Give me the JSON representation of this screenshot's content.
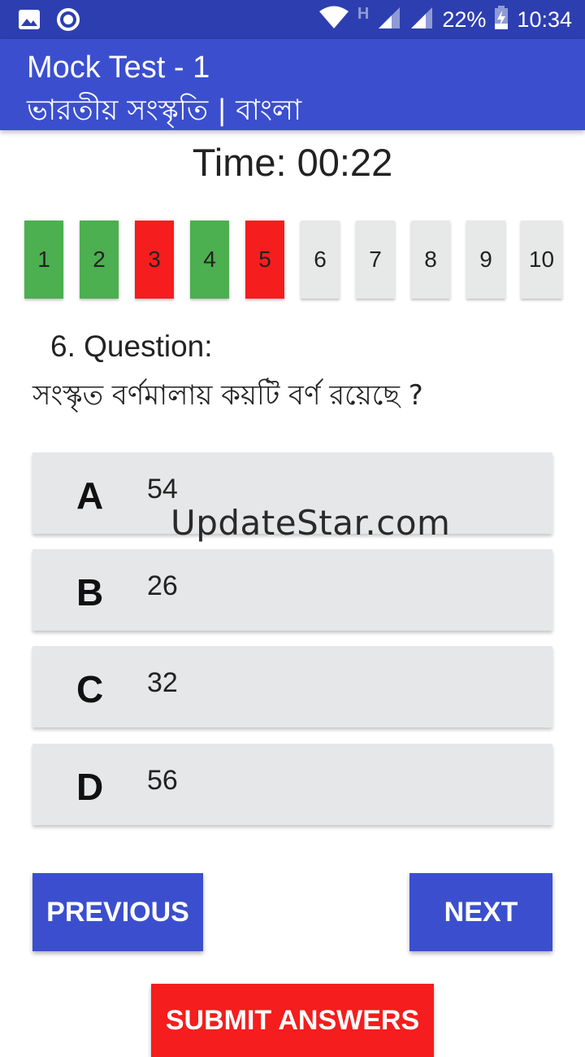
{
  "status_bar": {
    "icons": [
      "image-icon",
      "record-icon",
      "wifi-icon",
      "signal-icon",
      "signal-icon",
      "battery-charging-icon"
    ],
    "network_type": "H",
    "battery": "22%",
    "time": "10:34"
  },
  "app_bar": {
    "title": "Mock Test - 1",
    "subtitle": "ভারতীয় সংস্কৃতি | বাংলা"
  },
  "timer": {
    "label": "Time: 00:22"
  },
  "question_nav": {
    "items": [
      {
        "label": "1",
        "status": "correct"
      },
      {
        "label": "2",
        "status": "correct"
      },
      {
        "label": "3",
        "status": "wrong"
      },
      {
        "label": "4",
        "status": "correct"
      },
      {
        "label": "5",
        "status": "wrong"
      },
      {
        "label": "6",
        "status": "unanswered"
      },
      {
        "label": "7",
        "status": "unanswered"
      },
      {
        "label": "8",
        "status": "unanswered"
      },
      {
        "label": "9",
        "status": "unanswered"
      },
      {
        "label": "10",
        "status": "unanswered"
      }
    ]
  },
  "question": {
    "label": "6. Question:",
    "text": "সংস্কৃত বর্ণমালায় কয়টি বর্ণ রয়েছে ?"
  },
  "options": [
    {
      "letter": "A",
      "value": "54"
    },
    {
      "letter": "B",
      "value": "26"
    },
    {
      "letter": "C",
      "value": "32"
    },
    {
      "letter": "D",
      "value": "56"
    }
  ],
  "watermark": "UpdateStar.com",
  "buttons": {
    "previous": "PREVIOUS",
    "next": "NEXT",
    "submit": "SUBMIT ANSWERS"
  },
  "colors": {
    "primary": "#3b4fce",
    "status_bar": "#2d3fb0",
    "correct": "#4caf50",
    "wrong": "#f51d1d",
    "unanswered": "#e7e8e8",
    "submit": "#f51d1d"
  }
}
